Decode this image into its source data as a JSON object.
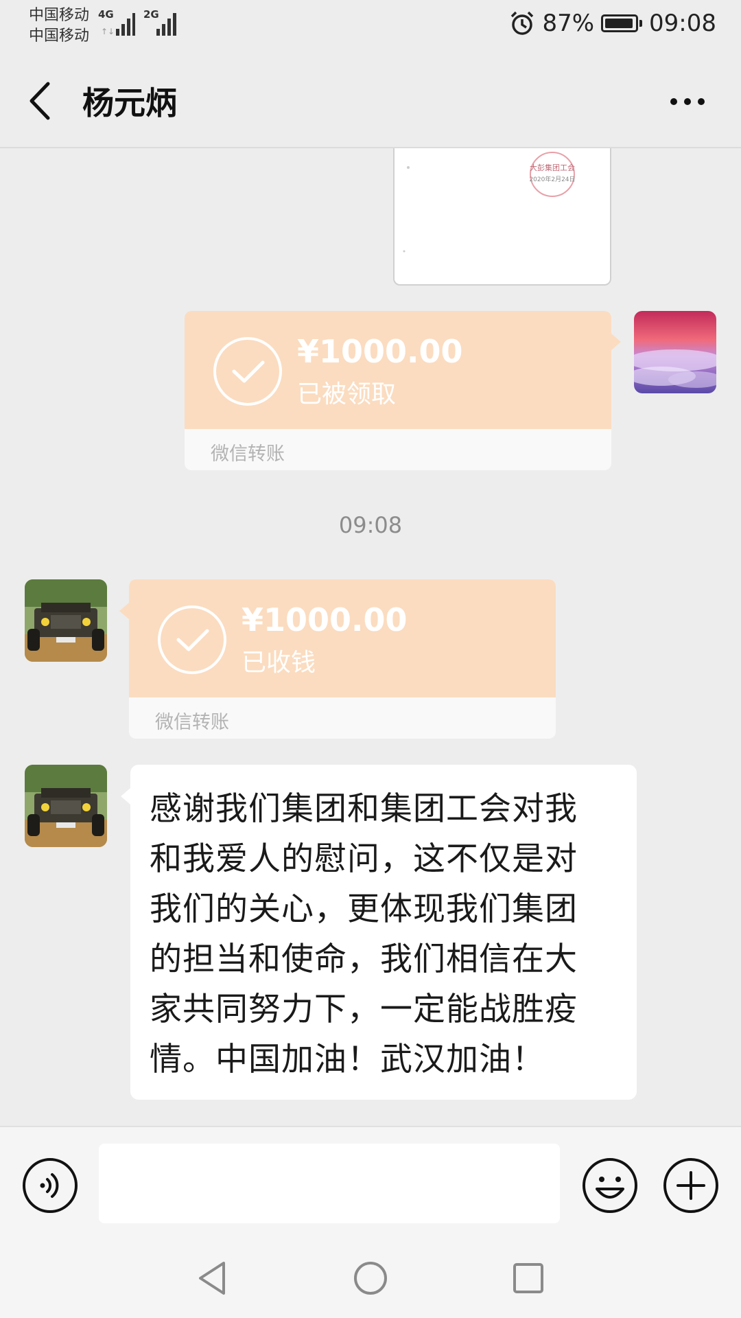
{
  "status_bar": {
    "carrier_1": "中国移动",
    "carrier_2": "中国移动",
    "network_1": "4G",
    "network_2": "2G",
    "battery": "87%",
    "time": "09:08"
  },
  "header": {
    "title": "杨元炳"
  },
  "messages": [
    {
      "type": "image",
      "side": "right",
      "stamp_text": "大彭集团工会",
      "stamp_date": "2020年2月24日"
    },
    {
      "type": "transfer",
      "side": "right",
      "amount": "¥1000.00",
      "state": "已被领取",
      "footer": "微信转账"
    },
    {
      "type": "timestamp",
      "text": "09:08"
    },
    {
      "type": "transfer",
      "side": "left",
      "amount": "¥1000.00",
      "state": "已收钱",
      "footer": "微信转账"
    },
    {
      "type": "text",
      "side": "left",
      "lines": [
        "感谢我们集团和集团工会对我",
        "和我爱人的慰问，这不仅是对",
        "我们的关心，更体现我们集团",
        "的担当和使命，我们相信在大",
        "家共同努力下，一定能战胜疫",
        "情。中国加油！武汉加油！"
      ]
    }
  ],
  "input_bar": {
    "value": "",
    "icons": [
      "voice-icon",
      "emoji-icon",
      "plus-icon"
    ]
  },
  "system_nav": {
    "icons": [
      "back-triangle-icon",
      "home-circle-icon",
      "recents-square-icon"
    ]
  },
  "colors": {
    "background": "#ededed",
    "transfer_orange": "#fbdcc0",
    "bubble_white": "#ffffff"
  }
}
